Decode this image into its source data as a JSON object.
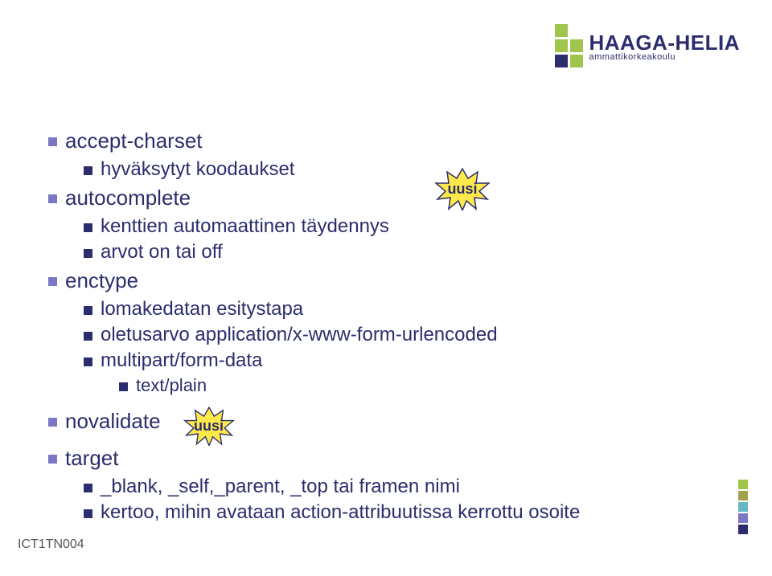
{
  "logo": {
    "name": "HAAGA-HELIA",
    "subtitle": "ammattikorkeakoulu",
    "colors": {
      "green": "#9fc54d",
      "darkblue": "#2b2d6d",
      "purple": "#7a78c5",
      "olive": "#a2a24c",
      "cyan": "#66b6c6"
    }
  },
  "badge": {
    "label": "uusi",
    "fill": "#ffe94a",
    "stroke": "#2b2d6d"
  },
  "bullets": {
    "accept_charset": {
      "title": "accept-charset",
      "sub1": "hyväksytyt koodaukset"
    },
    "autocomplete": {
      "title": "autocomplete",
      "sub1": "kenttien automaattinen täydennys",
      "sub2": "arvot on tai off"
    },
    "enctype": {
      "title": "enctype",
      "sub1": "lomakedatan esitystapa",
      "sub2": "oletusarvo application/x-www-form-urlencoded",
      "sub3": "multipart/form-data",
      "sub4": "text/plain"
    },
    "novalidate": {
      "title": "novalidate"
    },
    "target": {
      "title": "target",
      "sub1": "_blank, _self,_parent, _top tai framen nimi",
      "sub2": "kertoo, mihin avataan action-attribuutissa kerrottu osoite"
    }
  },
  "footer": {
    "code": "ICT1TN004"
  },
  "strip_colors": [
    "#9fc54d",
    "#a2a24c",
    "#66b6c6",
    "#7a78c5",
    "#2b2d6d"
  ]
}
